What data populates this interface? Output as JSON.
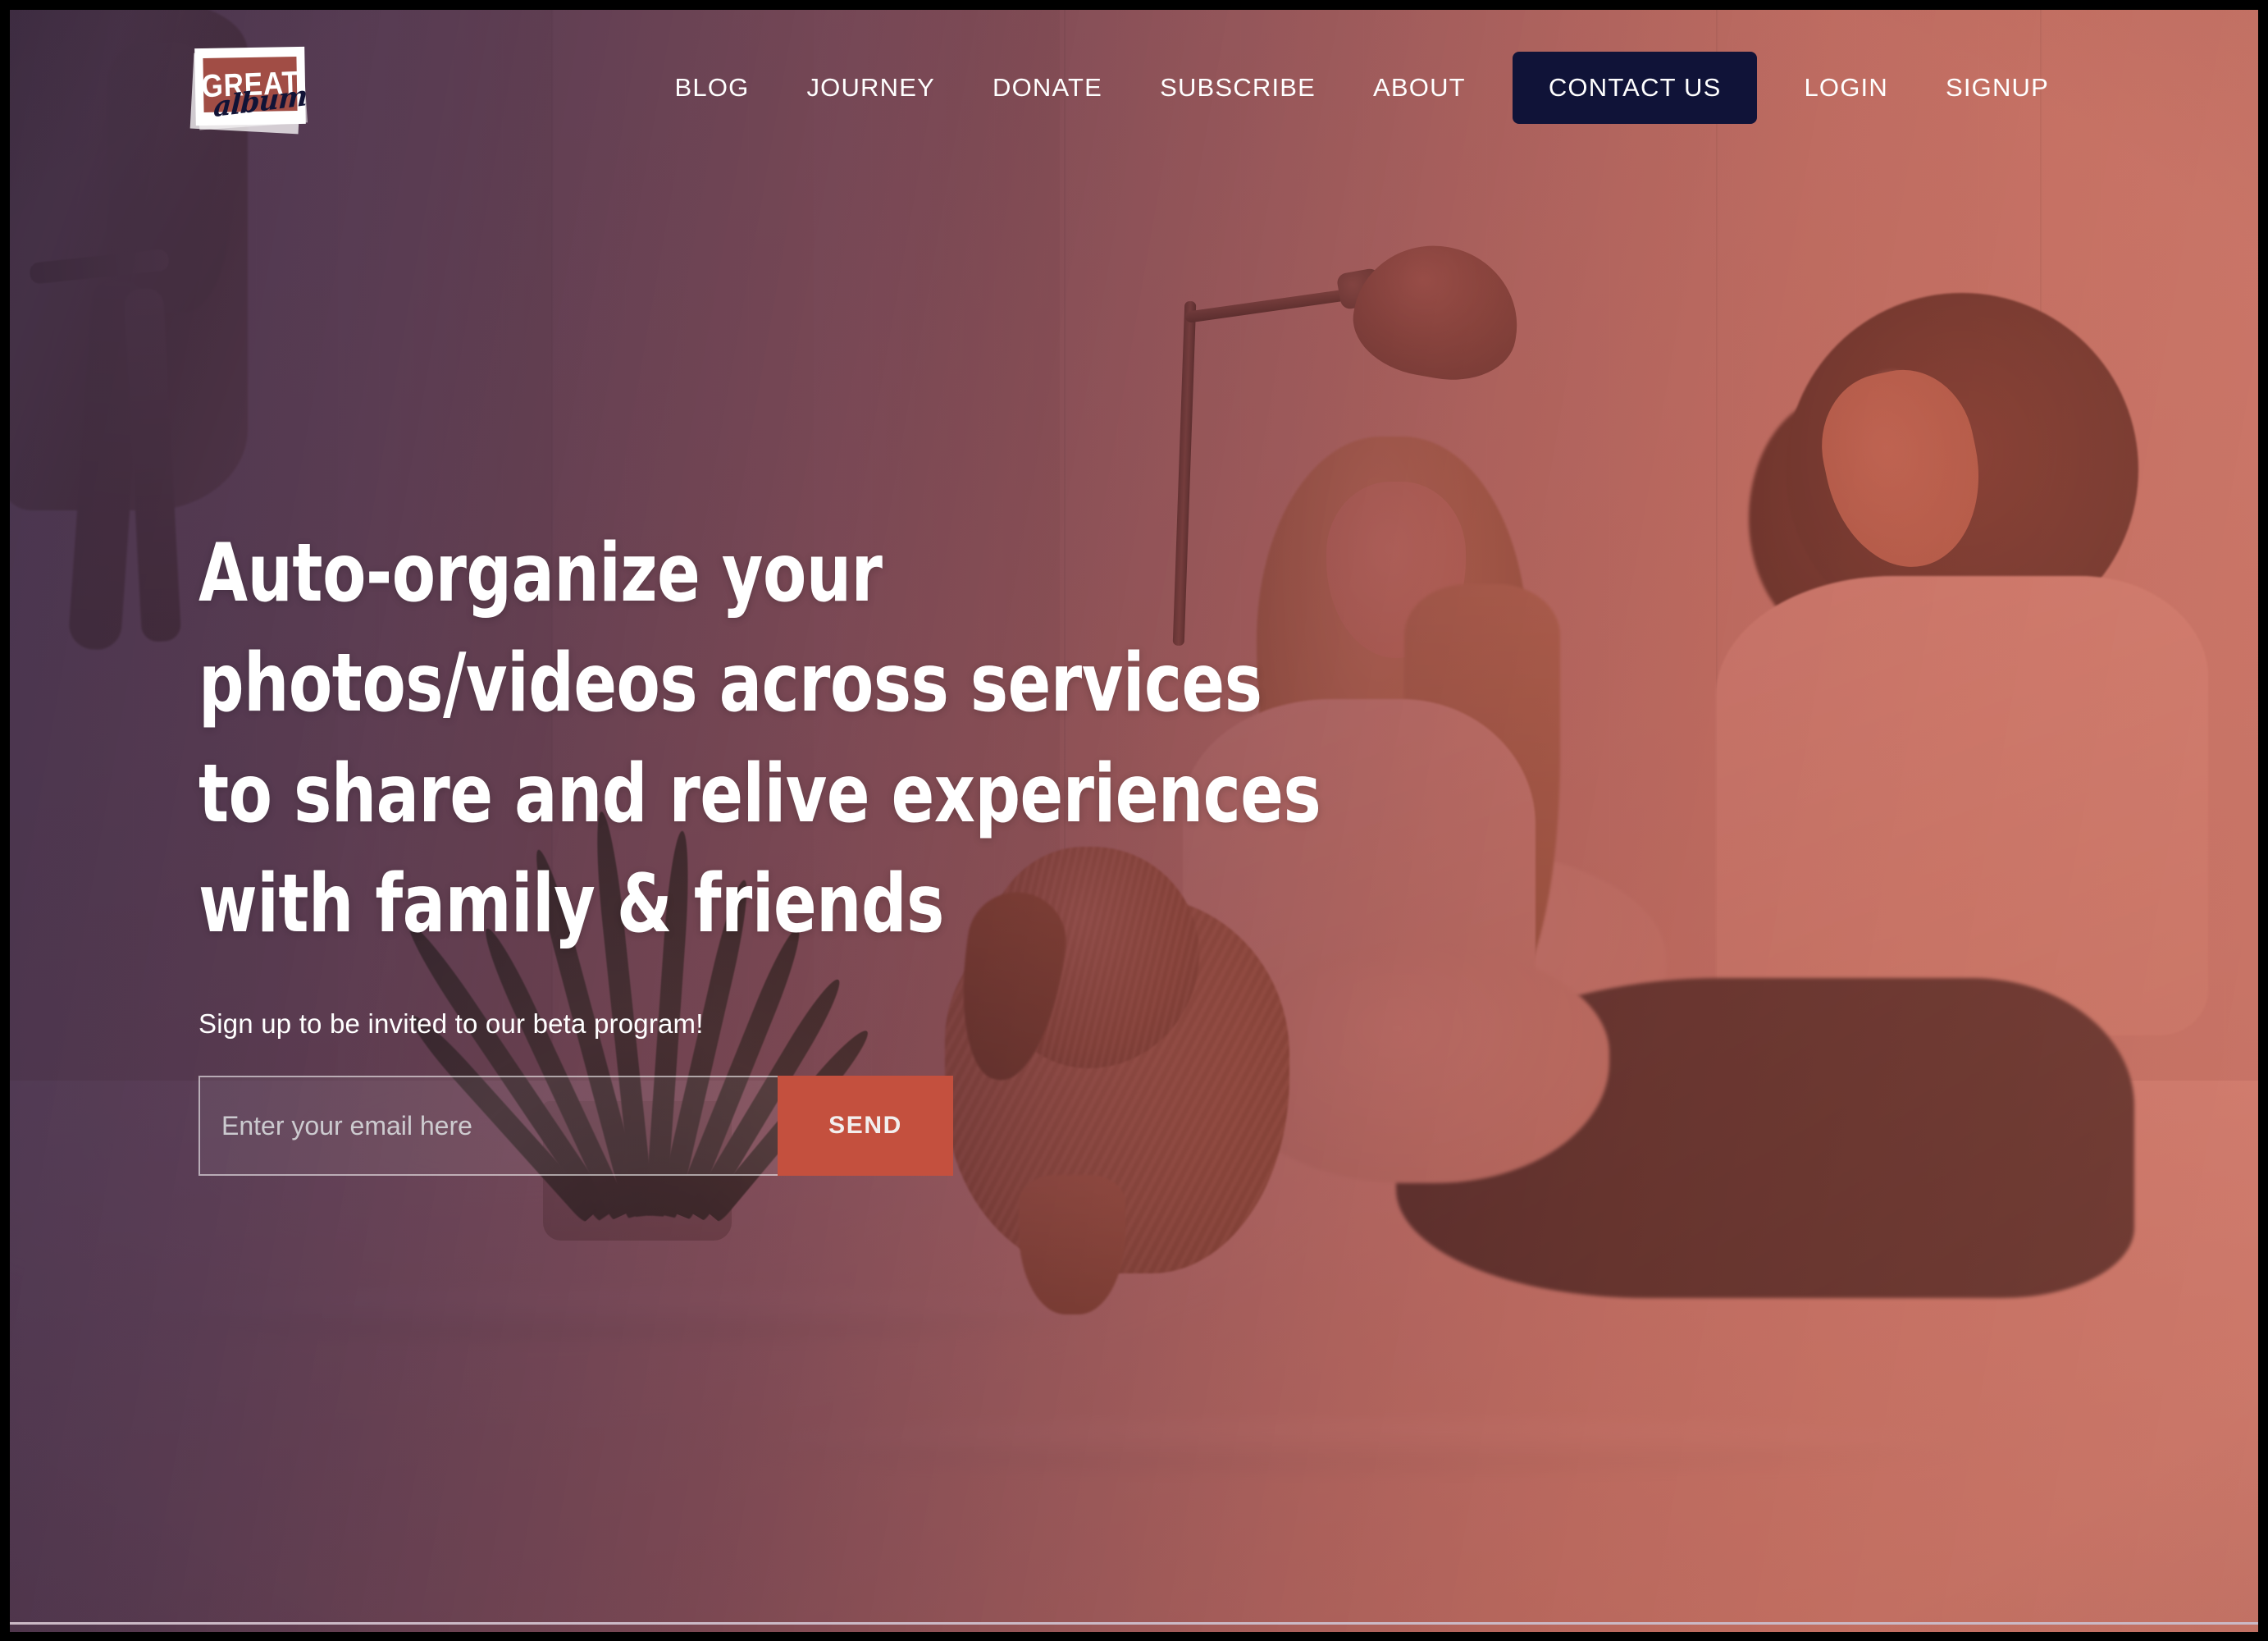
{
  "brand": {
    "logo_primary": "GREAT",
    "logo_script": "album",
    "logo_name": "The Great Album",
    "accent_red": "#c4503e",
    "navy": "#101338"
  },
  "nav": {
    "items": [
      {
        "label": "BLOG",
        "name": "nav-link-blog"
      },
      {
        "label": "JOURNEY",
        "name": "nav-link-journey"
      },
      {
        "label": "DONATE",
        "name": "nav-link-donate"
      },
      {
        "label": "SUBSCRIBE",
        "name": "nav-link-subscribe"
      },
      {
        "label": "ABOUT",
        "name": "nav-link-about"
      }
    ],
    "contact_label": "CONTACT US",
    "login_label": "LOGIN",
    "signup_label": "SIGNUP"
  },
  "hero": {
    "heading": "Auto-organize your photos/videos across services to share and relive experiences with family & friends",
    "subheading": "Sign up to be invited to our beta program!",
    "email_placeholder": "Enter your email here",
    "email_value": "",
    "send_label": "SEND"
  }
}
